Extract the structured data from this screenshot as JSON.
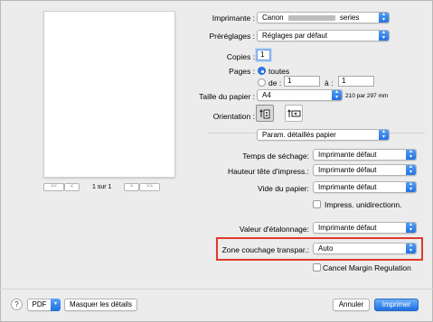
{
  "preview": {
    "page_indicator": "1 sur 1",
    "nav_first": "<<",
    "nav_prev": "<",
    "nav_next": ">",
    "nav_last": ">>"
  },
  "printer": {
    "label": "Imprimante :",
    "value_prefix": "Canon",
    "value_suffix": "series"
  },
  "presets": {
    "label": "Préréglages :",
    "value": "Réglages par défaut"
  },
  "copies": {
    "label": "Copies :",
    "value": "1"
  },
  "pages": {
    "label": "Pages :",
    "all_label": "toutes",
    "from_label": "de :",
    "from_value": "1",
    "to_label": "à :",
    "to_value": "1",
    "selected": "toutes"
  },
  "paper_size": {
    "label": "Taille du papier :",
    "value": "A4",
    "dimensions": "210 par 297 mm"
  },
  "orientation": {
    "label": "Orientation :"
  },
  "panel": {
    "value": "Param. détaillés papier"
  },
  "settings": {
    "drying_time": {
      "label": "Temps de séchage:",
      "value": "Imprimante défaut"
    },
    "head_height": {
      "label": "Hauteur tête d'impress.:",
      "value": "Imprimante défaut"
    },
    "paper_vacuum": {
      "label": "Vide du papier:",
      "value": "Imprimante défaut"
    },
    "unidirectional": {
      "label": "Impress. unidirectionn.",
      "checked": false
    },
    "calibration": {
      "label": "Valeur d'étalonnage:",
      "value": "Imprimante défaut"
    },
    "transparent_coating": {
      "label": "Zone couchage transpar.:",
      "value": "Auto"
    },
    "cancel_margin": {
      "label": "Cancel Margin Regulation",
      "checked": false
    }
  },
  "footer": {
    "help": "?",
    "pdf": "PDF",
    "hide_details": "Masquer les détails",
    "cancel": "Annuler",
    "print": "Imprimer"
  },
  "colors": {
    "accent": "#1f6fe0",
    "highlight_box": "#e03a2a"
  },
  "icons": {
    "popup_arrows": "up-down-chevrons-icon",
    "portrait": "portrait-orientation-icon",
    "landscape": "landscape-orientation-icon"
  }
}
